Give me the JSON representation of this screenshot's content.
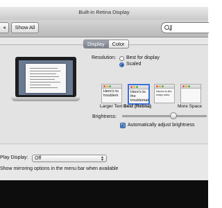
{
  "window": {
    "title": "Built-in Retina Display"
  },
  "toolbar": {
    "back_icon": "chevron-left-icon",
    "show_all_label": "Show All",
    "search": {
      "value": "",
      "placeholder": ""
    }
  },
  "tabs": [
    {
      "label": "Display",
      "selected": true
    },
    {
      "label": "Color",
      "selected": false
    }
  ],
  "resolution": {
    "label": "Resolution:",
    "options": [
      {
        "label": "Best for display",
        "selected": false
      },
      {
        "label": "Scaled",
        "selected": true
      }
    ]
  },
  "scaled_thumbs": [
    {
      "text": "Here's to troublem",
      "caption": "Larger Text",
      "selected": false
    },
    {
      "text": "Here's to the troublemake",
      "caption": "Best (Retina)",
      "selected": true
    },
    {
      "text": "Here's to the crazy ones",
      "caption": "",
      "selected": false
    },
    {
      "text": "",
      "caption": "More Space",
      "selected": false
    }
  ],
  "brightness": {
    "label": "Brightness:",
    "level": 0.62,
    "auto_adjust_label": "Automatically adjust brightness",
    "auto_adjust_checked": true
  },
  "airplay": {
    "label": "Play Display:",
    "selected_value": "Off"
  },
  "mirroring_label": "Show mirroring options in the menu bar when available",
  "colors": {
    "selection_blue": "#3a6fd8",
    "tab_selected": "#7b818b"
  }
}
